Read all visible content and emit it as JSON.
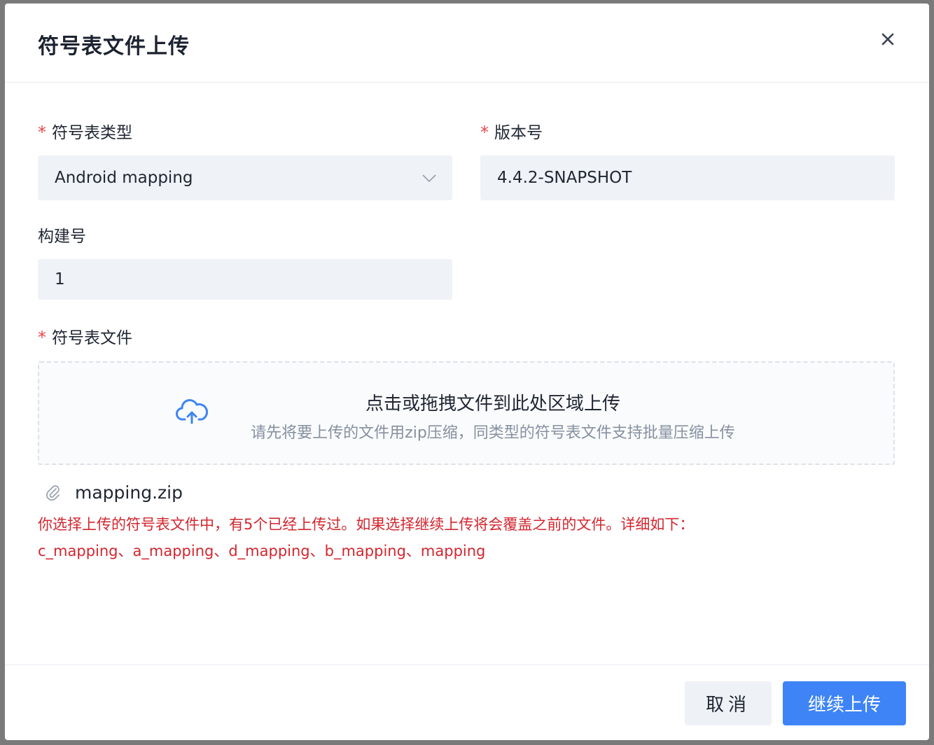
{
  "dialog": {
    "title": "符号表文件上传",
    "close_icon": "close-icon"
  },
  "form": {
    "symbol_type": {
      "required_mark": "*",
      "label": "符号表类型",
      "value": "Android mapping",
      "icon": "chevron-down-icon"
    },
    "version": {
      "required_mark": "*",
      "label": "版本号",
      "value": "4.4.2-SNAPSHOT"
    },
    "build": {
      "label": "构建号",
      "value": "1"
    },
    "file": {
      "required_mark": "*",
      "label": "符号表文件"
    }
  },
  "dropzone": {
    "icon": "cloud-upload-icon",
    "title": "点击或拖拽文件到此处区域上传",
    "hint": "请先将要上传的文件用zip压缩，同类型的符号表文件支持批量压缩上传"
  },
  "uploaded_file": {
    "icon": "paperclip-icon",
    "name": "mapping.zip"
  },
  "warning": {
    "line1": "你选择上传的符号表文件中，有5个已经上传过。如果选择继续上传将会覆盖之前的文件。详细如下：",
    "line2": "c_mapping、a_mapping、d_mapping、b_mapping、mapping"
  },
  "footer": {
    "cancel_label": "取消",
    "confirm_label": "继续上传"
  },
  "colors": {
    "primary": "#3e84f7",
    "danger": "#d3262e",
    "required": "#e5484d",
    "field_bg": "#eff2f6"
  }
}
